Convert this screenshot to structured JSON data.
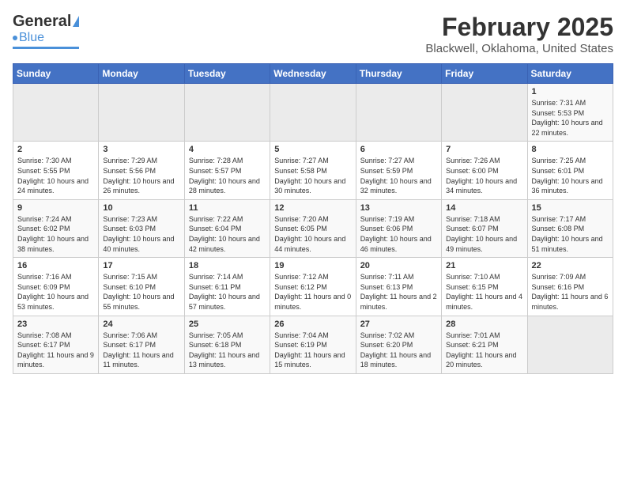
{
  "header": {
    "logo_general": "General",
    "logo_blue": "Blue",
    "month_title": "February 2025",
    "location": "Blackwell, Oklahoma, United States"
  },
  "weekdays": [
    "Sunday",
    "Monday",
    "Tuesday",
    "Wednesday",
    "Thursday",
    "Friday",
    "Saturday"
  ],
  "weeks": [
    [
      {
        "day": "",
        "empty": true
      },
      {
        "day": "",
        "empty": true
      },
      {
        "day": "",
        "empty": true
      },
      {
        "day": "",
        "empty": true
      },
      {
        "day": "",
        "empty": true
      },
      {
        "day": "",
        "empty": true
      },
      {
        "day": "1",
        "sunrise": "7:31 AM",
        "sunset": "5:53 PM",
        "daylight": "10 hours and 22 minutes."
      }
    ],
    [
      {
        "day": "2",
        "sunrise": "7:30 AM",
        "sunset": "5:55 PM",
        "daylight": "10 hours and 24 minutes."
      },
      {
        "day": "3",
        "sunrise": "7:29 AM",
        "sunset": "5:56 PM",
        "daylight": "10 hours and 26 minutes."
      },
      {
        "day": "4",
        "sunrise": "7:28 AM",
        "sunset": "5:57 PM",
        "daylight": "10 hours and 28 minutes."
      },
      {
        "day": "5",
        "sunrise": "7:27 AM",
        "sunset": "5:58 PM",
        "daylight": "10 hours and 30 minutes."
      },
      {
        "day": "6",
        "sunrise": "7:27 AM",
        "sunset": "5:59 PM",
        "daylight": "10 hours and 32 minutes."
      },
      {
        "day": "7",
        "sunrise": "7:26 AM",
        "sunset": "6:00 PM",
        "daylight": "10 hours and 34 minutes."
      },
      {
        "day": "8",
        "sunrise": "7:25 AM",
        "sunset": "6:01 PM",
        "daylight": "10 hours and 36 minutes."
      }
    ],
    [
      {
        "day": "9",
        "sunrise": "7:24 AM",
        "sunset": "6:02 PM",
        "daylight": "10 hours and 38 minutes."
      },
      {
        "day": "10",
        "sunrise": "7:23 AM",
        "sunset": "6:03 PM",
        "daylight": "10 hours and 40 minutes."
      },
      {
        "day": "11",
        "sunrise": "7:22 AM",
        "sunset": "6:04 PM",
        "daylight": "10 hours and 42 minutes."
      },
      {
        "day": "12",
        "sunrise": "7:20 AM",
        "sunset": "6:05 PM",
        "daylight": "10 hours and 44 minutes."
      },
      {
        "day": "13",
        "sunrise": "7:19 AM",
        "sunset": "6:06 PM",
        "daylight": "10 hours and 46 minutes."
      },
      {
        "day": "14",
        "sunrise": "7:18 AM",
        "sunset": "6:07 PM",
        "daylight": "10 hours and 49 minutes."
      },
      {
        "day": "15",
        "sunrise": "7:17 AM",
        "sunset": "6:08 PM",
        "daylight": "10 hours and 51 minutes."
      }
    ],
    [
      {
        "day": "16",
        "sunrise": "7:16 AM",
        "sunset": "6:09 PM",
        "daylight": "10 hours and 53 minutes."
      },
      {
        "day": "17",
        "sunrise": "7:15 AM",
        "sunset": "6:10 PM",
        "daylight": "10 hours and 55 minutes."
      },
      {
        "day": "18",
        "sunrise": "7:14 AM",
        "sunset": "6:11 PM",
        "daylight": "10 hours and 57 minutes."
      },
      {
        "day": "19",
        "sunrise": "7:12 AM",
        "sunset": "6:12 PM",
        "daylight": "11 hours and 0 minutes."
      },
      {
        "day": "20",
        "sunrise": "7:11 AM",
        "sunset": "6:13 PM",
        "daylight": "11 hours and 2 minutes."
      },
      {
        "day": "21",
        "sunrise": "7:10 AM",
        "sunset": "6:15 PM",
        "daylight": "11 hours and 4 minutes."
      },
      {
        "day": "22",
        "sunrise": "7:09 AM",
        "sunset": "6:16 PM",
        "daylight": "11 hours and 6 minutes."
      }
    ],
    [
      {
        "day": "23",
        "sunrise": "7:08 AM",
        "sunset": "6:17 PM",
        "daylight": "11 hours and 9 minutes."
      },
      {
        "day": "24",
        "sunrise": "7:06 AM",
        "sunset": "6:17 PM",
        "daylight": "11 hours and 11 minutes."
      },
      {
        "day": "25",
        "sunrise": "7:05 AM",
        "sunset": "6:18 PM",
        "daylight": "11 hours and 13 minutes."
      },
      {
        "day": "26",
        "sunrise": "7:04 AM",
        "sunset": "6:19 PM",
        "daylight": "11 hours and 15 minutes."
      },
      {
        "day": "27",
        "sunrise": "7:02 AM",
        "sunset": "6:20 PM",
        "daylight": "11 hours and 18 minutes."
      },
      {
        "day": "28",
        "sunrise": "7:01 AM",
        "sunset": "6:21 PM",
        "daylight": "11 hours and 20 minutes."
      },
      {
        "day": "",
        "empty": true
      }
    ]
  ],
  "labels": {
    "sunrise": "Sunrise:",
    "sunset": "Sunset:",
    "daylight": "Daylight:"
  }
}
